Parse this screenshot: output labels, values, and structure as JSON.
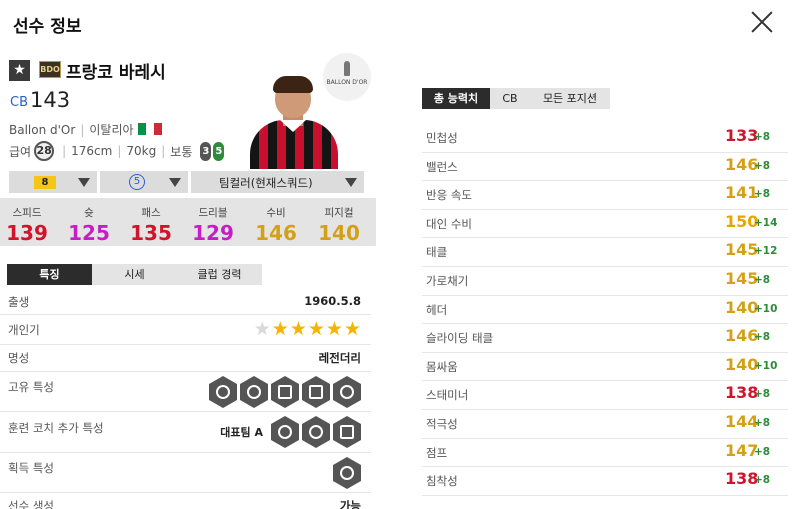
{
  "window": {
    "title": "선수 정보"
  },
  "player": {
    "name": "프랑코 바레시",
    "season_badge": "BDO",
    "position": "CB",
    "ovr": "143",
    "club": "Ballon d'Or",
    "nation": "이탈리아",
    "salary_label": "급여",
    "salary": "28",
    "height": "176cm",
    "weight": "70kg",
    "body_type": "보통",
    "left_foot": "3",
    "right_foot": "5",
    "logo_text": "BALLON D'OR"
  },
  "selectors": {
    "grade": "8",
    "team": "5",
    "chemistry": "팀컬러(현재스쿼드)"
  },
  "stats_bar": [
    {
      "label": "스피드",
      "value": "139",
      "color": "#d0142c"
    },
    {
      "label": "슛",
      "value": "125",
      "color": "#c41fc4"
    },
    {
      "label": "패스",
      "value": "135",
      "color": "#d0142c"
    },
    {
      "label": "드리블",
      "value": "129",
      "color": "#c41fc4"
    },
    {
      "label": "수비",
      "value": "146",
      "color": "#d4a017"
    },
    {
      "label": "피지컬",
      "value": "140",
      "color": "#d4a017"
    }
  ],
  "left_tabs": [
    "특징",
    "시세",
    "클럽 경력"
  ],
  "right_tabs": [
    "총 능력치",
    "CB",
    "모든 포지션"
  ],
  "details": {
    "birth_label": "출생",
    "birth": "1960.5.8",
    "popularity_label": "개인기",
    "popularity_stars": 5,
    "popularity_max": 6,
    "fame_label": "명성",
    "fame": "레전더리",
    "traits_label": "고유 특성",
    "coach_label": "훈련 코치 추가 특성",
    "coach_value": "대표팀 A",
    "acquired_label": "획득 특성",
    "create_label": "선수 생성",
    "create_value": "가능"
  },
  "attributes": [
    {
      "name": "민첩성",
      "value": "133",
      "bonus": "+8",
      "color": "#d0142c"
    },
    {
      "name": "밸런스",
      "value": "146",
      "bonus": "+8",
      "color": "#d4a017"
    },
    {
      "name": "반응 속도",
      "value": "141",
      "bonus": "+8",
      "color": "#d4a017"
    },
    {
      "name": "대인 수비",
      "value": "150",
      "bonus": "+14",
      "color": "#e8a500"
    },
    {
      "name": "태클",
      "value": "145",
      "bonus": "+12",
      "color": "#d4a017"
    },
    {
      "name": "가로채기",
      "value": "145",
      "bonus": "+8",
      "color": "#d4a017"
    },
    {
      "name": "헤더",
      "value": "140",
      "bonus": "+10",
      "color": "#d4a017"
    },
    {
      "name": "슬라이딩 태클",
      "value": "146",
      "bonus": "+8",
      "color": "#d4a017"
    },
    {
      "name": "몸싸움",
      "value": "140",
      "bonus": "+10",
      "color": "#d4a017"
    },
    {
      "name": "스태미너",
      "value": "138",
      "bonus": "+8",
      "color": "#d0142c"
    },
    {
      "name": "적극성",
      "value": "144",
      "bonus": "+8",
      "color": "#d4a017"
    },
    {
      "name": "점프",
      "value": "147",
      "bonus": "+8",
      "color": "#d4a017"
    },
    {
      "name": "침착성",
      "value": "138",
      "bonus": "+8",
      "color": "#d0142c"
    }
  ]
}
